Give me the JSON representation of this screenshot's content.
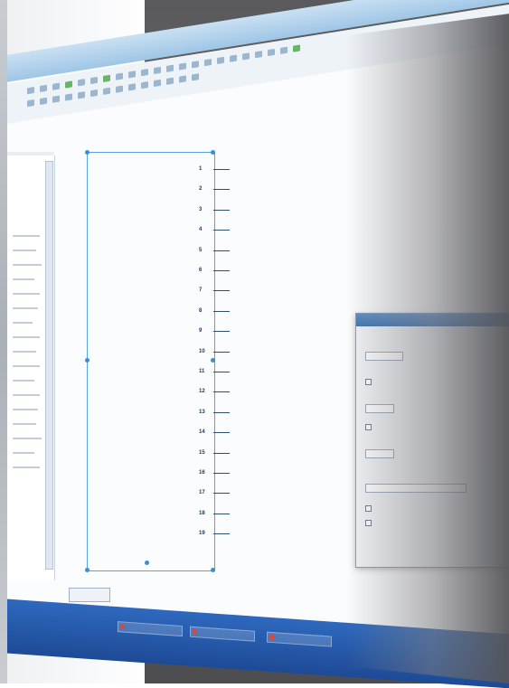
{
  "window": {
    "title": ""
  },
  "component": {
    "name_label": "",
    "pins": [
      {
        "label": "",
        "num": "1"
      },
      {
        "label": "",
        "num": "2"
      },
      {
        "label": "",
        "num": "3"
      },
      {
        "label": "",
        "num": "4"
      },
      {
        "label": "",
        "num": "5"
      },
      {
        "label": "",
        "num": "6"
      },
      {
        "label": "",
        "num": "7"
      },
      {
        "label": "",
        "num": "8"
      },
      {
        "label": "",
        "num": "9"
      },
      {
        "label": "",
        "num": "10"
      },
      {
        "label": "",
        "num": "11"
      },
      {
        "label": "",
        "num": "12"
      },
      {
        "label": "",
        "num": "13"
      },
      {
        "label": "",
        "num": "14"
      },
      {
        "label": "",
        "num": "15"
      },
      {
        "label": "",
        "num": "16"
      },
      {
        "label": "",
        "num": "17"
      },
      {
        "label": "",
        "num": "18"
      },
      {
        "label": "",
        "num": "19"
      }
    ]
  },
  "status_tab": {
    "label": ""
  },
  "colors": {
    "accent": "#56a6dd",
    "taskbar": "#2e69bf",
    "dialog_title": "#3f75b2"
  }
}
